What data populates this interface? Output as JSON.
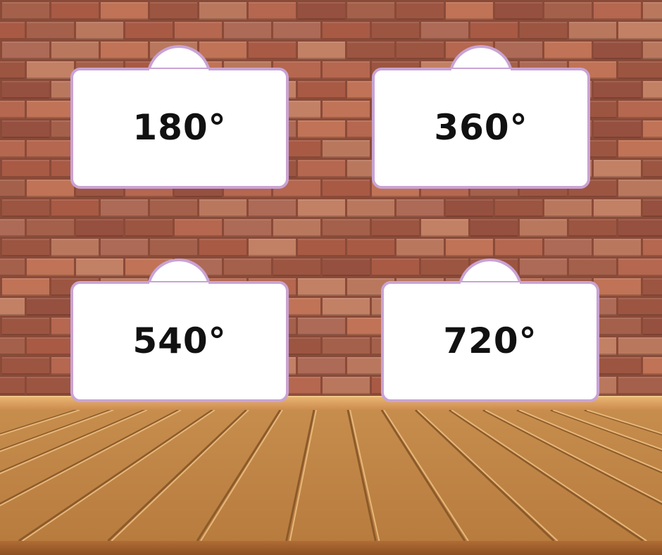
{
  "scene": {
    "colors": {
      "wall": "#a4604a",
      "mortar": "#8a4a38",
      "floor": "#c68d4d",
      "sign_border": "#c9a3d3",
      "sign_fill": "#ffffff",
      "label": "#111111"
    }
  },
  "options": [
    {
      "label": "180°"
    },
    {
      "label": "360°"
    },
    {
      "label": "540°"
    },
    {
      "label": "720°"
    }
  ]
}
